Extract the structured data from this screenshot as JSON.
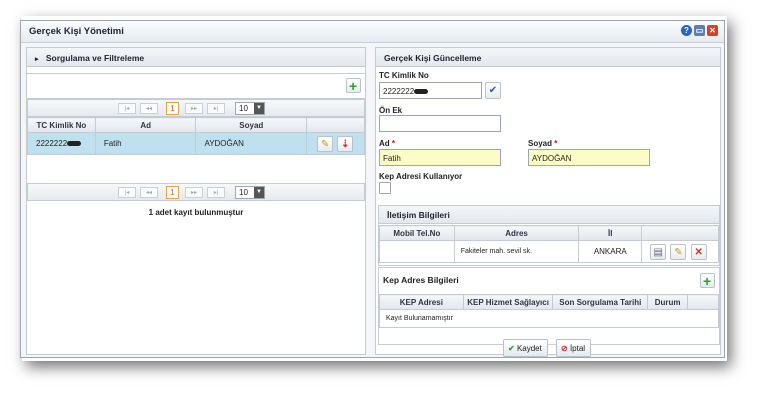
{
  "window": {
    "title": "Gerçek Kişi Yönetimi"
  },
  "left": {
    "filter_title": "Sorgulama ve Filtreleme",
    "pager_top": {
      "page": "1",
      "page_size": "10"
    },
    "pager_bottom": {
      "page": "1",
      "page_size": "10"
    },
    "columns": [
      "TC Kimlik No",
      "Ad",
      "Soyad"
    ],
    "rows": [
      {
        "tc": "2222222",
        "ad": "Fatih",
        "soyad": "AYDOĞAN"
      }
    ],
    "result_text": "1 adet kayıt bulunmuştur"
  },
  "right": {
    "title": "Gerçek Kişi Güncelleme",
    "tc_label": "TC Kimlik No",
    "tc_value": "2222222",
    "onek_label": "Ön Ek",
    "onek_value": "",
    "ad_label": "Ad",
    "ad_value": "Fatih",
    "soyad_label": "Soyad",
    "soyad_value": "AYDOĞAN",
    "required_mark": "*",
    "kep_label": "Kep Adresi Kullanıyor",
    "iletisim": {
      "title": "İletişim Bilgileri",
      "columns": [
        "Mobil Tel.No",
        "Adres",
        "İl"
      ],
      "rows": [
        {
          "tel": "",
          "adres": "Fakiteler mah. sevil sk.",
          "il": "ANKARA"
        }
      ]
    },
    "kep": {
      "title": "Kep Adres Bilgileri",
      "columns": [
        "KEP Adresi",
        "KEP Hizmet Sağlayıcı",
        "Son Sorgulama Tarihi",
        "Durum"
      ],
      "empty_text": "Kayıt Bulunamamıştır"
    },
    "save_label": "Kaydet",
    "cancel_label": "İptal"
  },
  "colors": {
    "accent": "#2f9e2f",
    "selected_row": "#bfe1ef",
    "required_field": "#fdfbc7",
    "cancel_icon": "#c0392b"
  }
}
